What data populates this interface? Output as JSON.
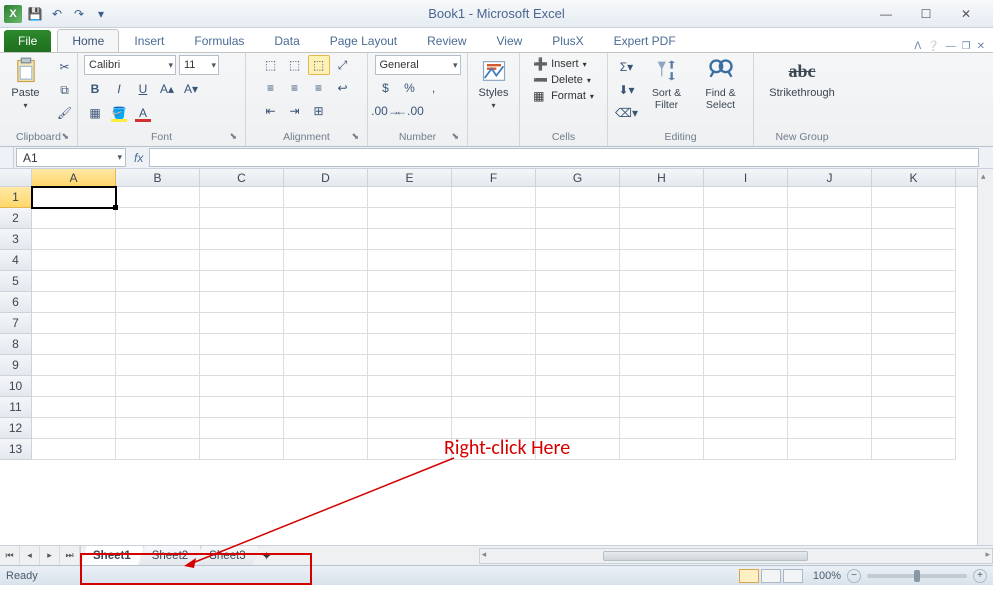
{
  "title": "Book1 - Microsoft Excel",
  "qat": {
    "save": "💾",
    "undo": "↶",
    "redo": "↷"
  },
  "tabs": {
    "file": "File",
    "items": [
      "Home",
      "Insert",
      "Formulas",
      "Data",
      "Page Layout",
      "Review",
      "View",
      "PlusX",
      "Expert PDF"
    ],
    "active": "Home"
  },
  "ribbon": {
    "clipboard": {
      "paste": "Paste",
      "label": "Clipboard"
    },
    "font": {
      "name": "Calibri",
      "size": "11",
      "label": "Font"
    },
    "alignment": {
      "label": "Alignment"
    },
    "number": {
      "format": "General",
      "label": "Number"
    },
    "styles": {
      "btn": "Styles",
      "label": ""
    },
    "cells": {
      "insert": "Insert",
      "delete": "Delete",
      "format": "Format",
      "label": "Cells"
    },
    "editing": {
      "sort": "Sort &\nFilter",
      "find": "Find &\nSelect",
      "label": "Editing"
    },
    "newgroup": {
      "strike": "Strikethrough",
      "label": "New Group"
    }
  },
  "namebox": "A1",
  "fx": "fx",
  "columns": [
    "A",
    "B",
    "C",
    "D",
    "E",
    "F",
    "G",
    "H",
    "I",
    "J",
    "K"
  ],
  "rows": [
    "1",
    "2",
    "3",
    "4",
    "5",
    "6",
    "7",
    "8",
    "9",
    "10",
    "11",
    "12",
    "13"
  ],
  "active_cell": {
    "col": "A",
    "row": "1"
  },
  "sheets": {
    "items": [
      "Sheet1",
      "Sheet2",
      "Sheet3"
    ],
    "active": "Sheet1"
  },
  "status": {
    "ready": "Ready",
    "zoom": "100%"
  },
  "annotation": "Right-click Here"
}
